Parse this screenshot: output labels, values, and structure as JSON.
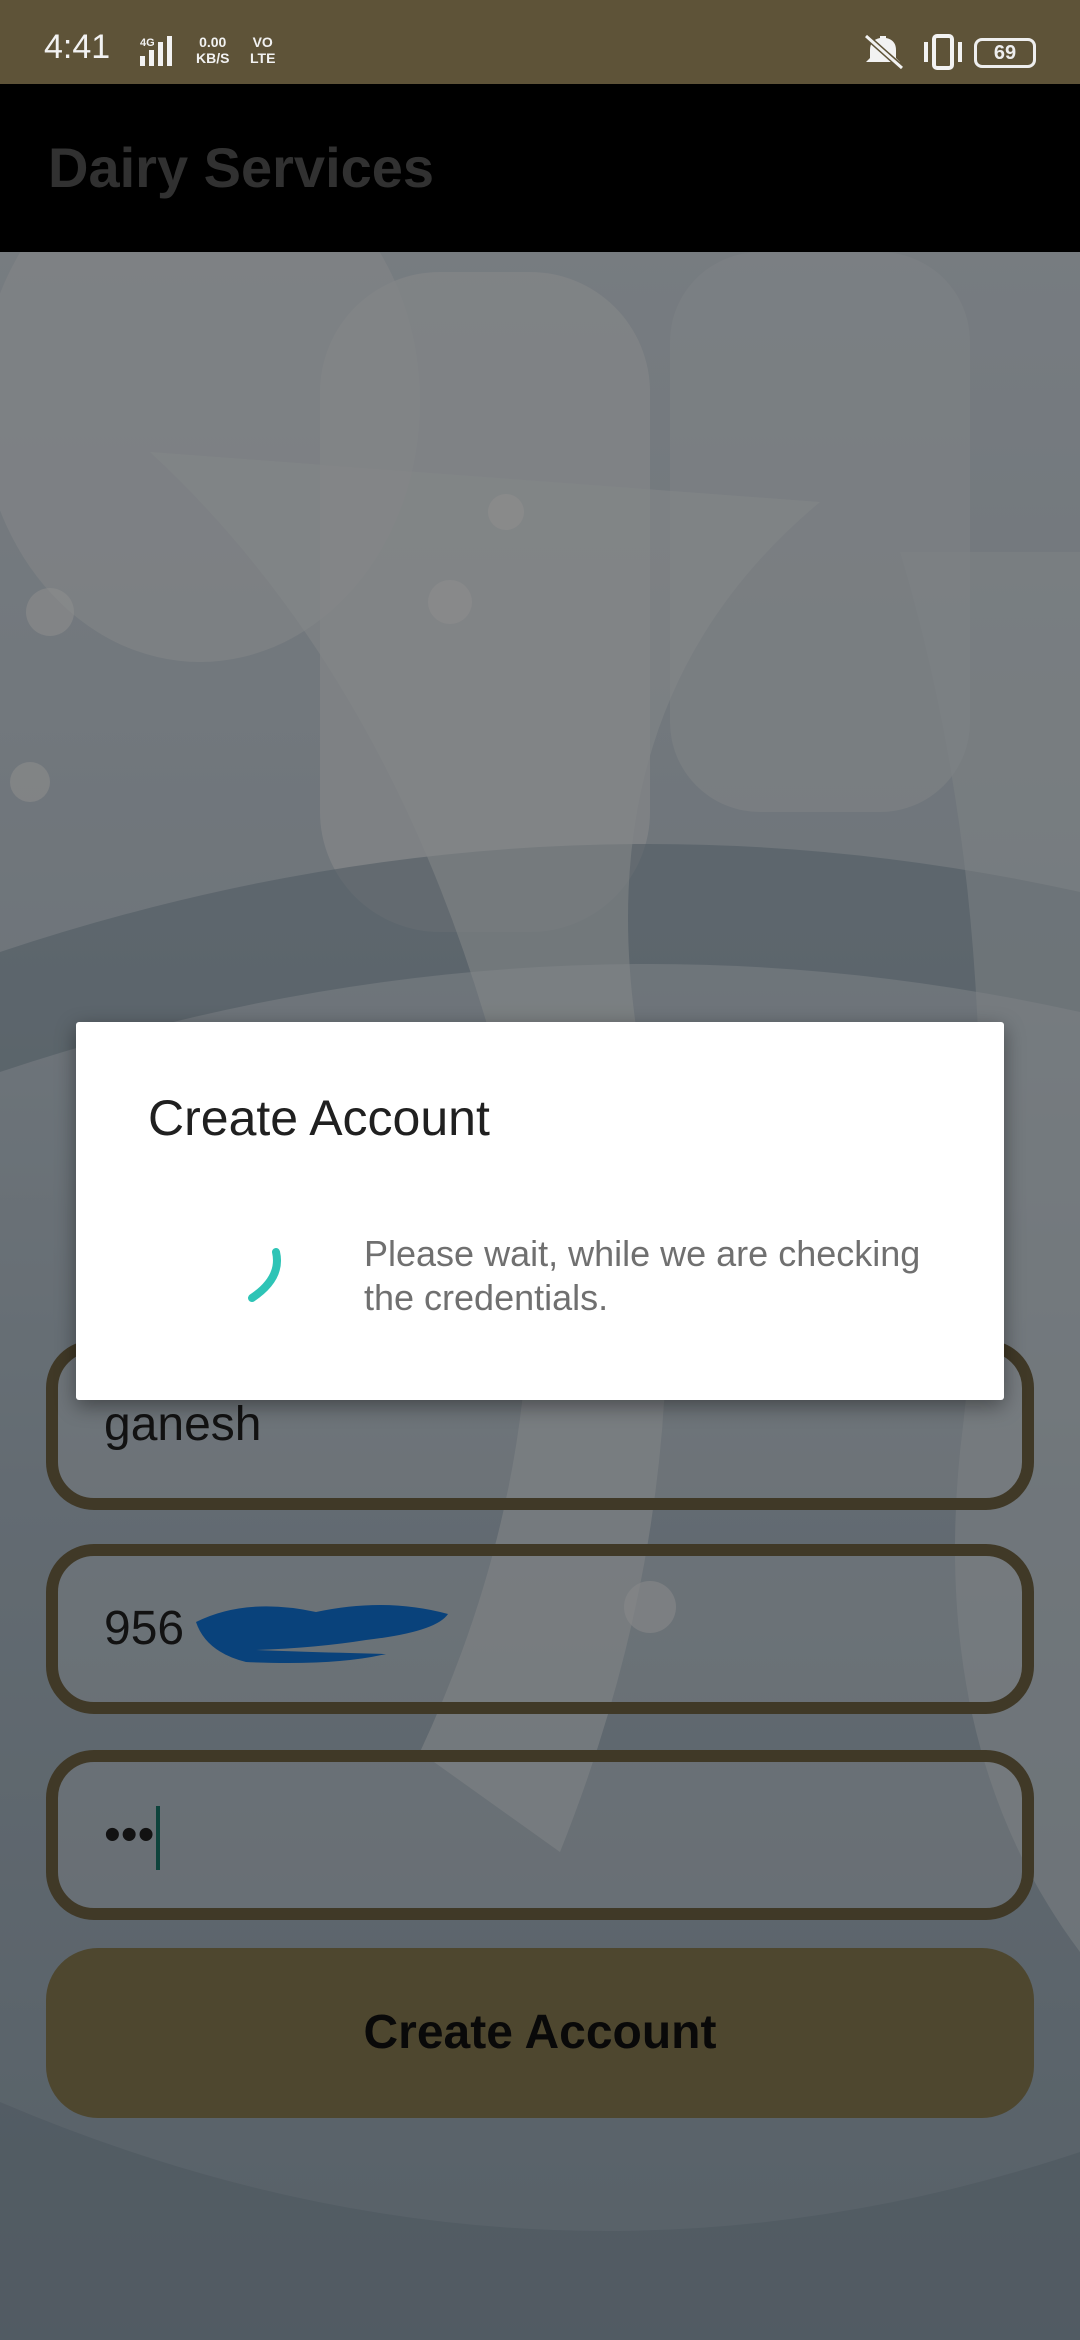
{
  "status_bar": {
    "time": "4:41",
    "network_label": "4G",
    "speed_value": "0.00",
    "speed_unit": "KB/S",
    "volte_top": "VO",
    "volte_bottom": "LTE",
    "battery": "69"
  },
  "app_bar": {
    "title": "Dairy Services"
  },
  "form": {
    "name_value": "ganesh",
    "phone_value": "956",
    "password_value": "•••",
    "submit_label": "Create Account"
  },
  "dialog": {
    "title": "Create Account",
    "message": "Please wait, while we are checking the credentials."
  },
  "colors": {
    "status_bar_bg": "#5e5338",
    "field_border": "#756848",
    "button_bg": "#8f8257",
    "spinner": "#2ec4b6"
  }
}
